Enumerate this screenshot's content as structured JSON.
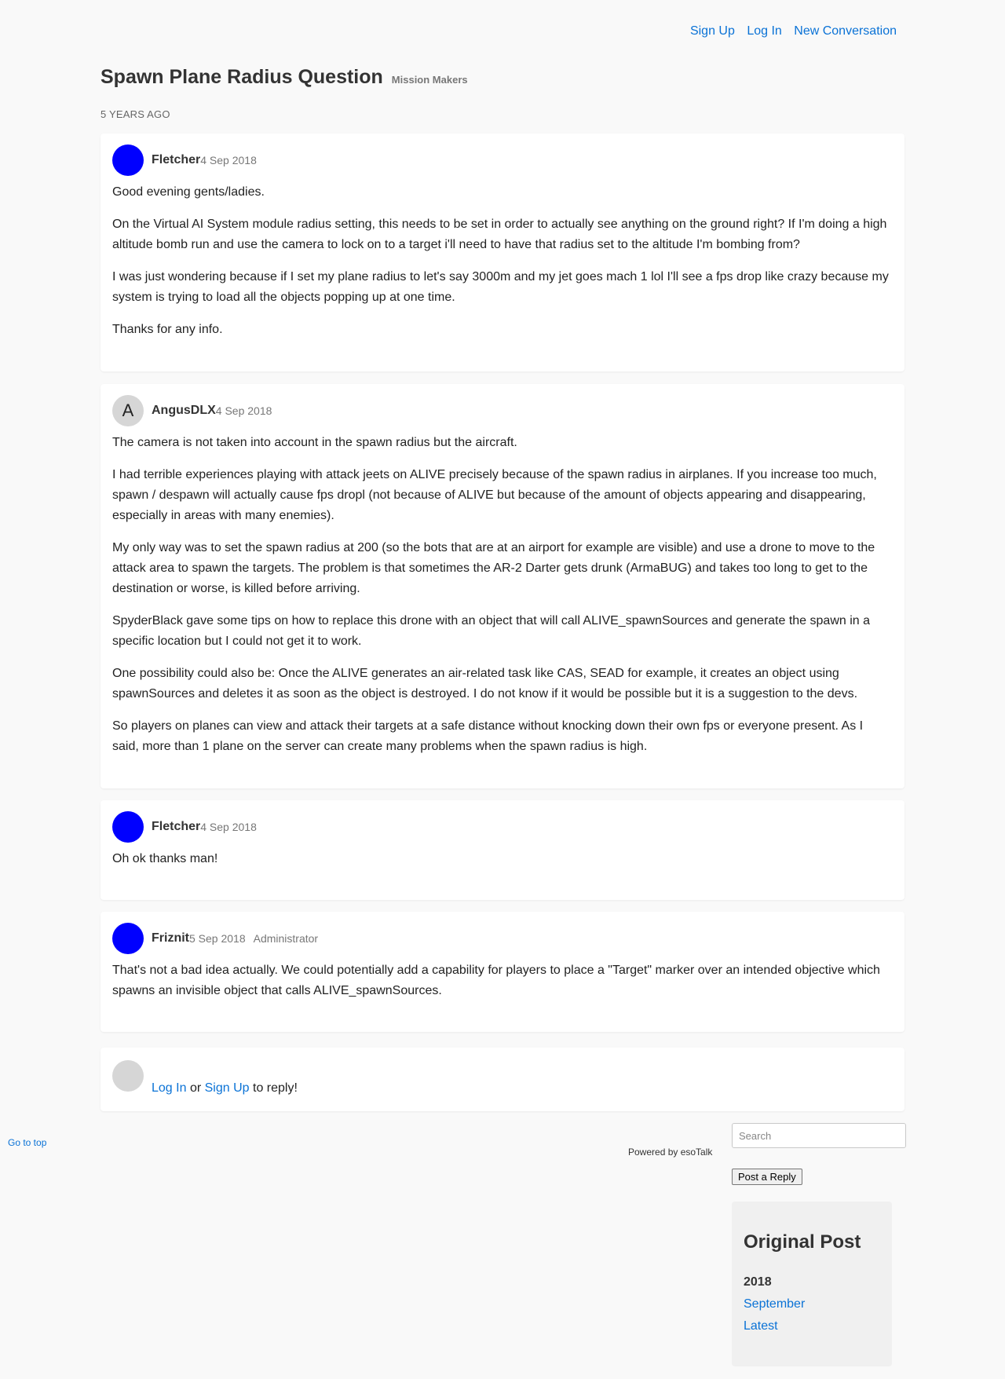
{
  "nav": {
    "sign_up": "Sign Up",
    "log_in": "Log In",
    "new_conversation": "New Conversation"
  },
  "conversation": {
    "title": "Spawn Plane Radius Question",
    "channel": "Mission Makers",
    "age": "5 YEARS AGO"
  },
  "posts": [
    {
      "username": "Fletcher",
      "date": "4 Sep 2018",
      "role": "",
      "avatar_letter": "",
      "avatar_color": "#0000ff",
      "paragraphs": [
        "Good evening gents/ladies.",
        "On the Virtual AI System module radius setting, this needs to be set in order to actually see anything on the ground right? If I'm doing a high altitude bomb run and use the camera to lock on to a target i'll need to have that radius set to the altitude I'm bombing from?",
        "I was just wondering because if I set my plane radius to let's say 3000m and my jet goes mach 1 lol I'll see a fps drop like crazy because my system is trying to load all the objects popping up at one time.",
        "Thanks for any info."
      ]
    },
    {
      "username": "AngusDLX",
      "date": "4 Sep 2018",
      "role": "",
      "avatar_letter": "A",
      "avatar_color": "#d6d6d6",
      "paragraphs": [
        "The camera is not taken into account in the spawn radius but the aircraft.",
        "I had terrible experiences playing with attack jeets on ALIVE precisely because of the spawn radius in airplanes. If you increase too much, spawn / despawn will actually cause fps dropl (not because of ALIVE but because of the amount of objects appearing and disappearing, especially in areas with many enemies).",
        "My only way was to set the spawn radius at 200 (so the bots that are at an airport for example are visible) and use a drone to move to the attack area to spawn the targets. The problem is that sometimes the AR-2 Darter gets drunk (ArmaBUG) and takes too long to get to the destination or worse, is killed before arriving.",
        "SpyderBlack gave some tips on how to replace this drone with an object that will call ALIVE_spawnSources and generate the spawn in a specific location but I could not get it to work.",
        "One possibility could also be: Once the ALIVE generates an air-related task like CAS, SEAD for example, it creates an object using spawnSources and deletes it as soon as the object is destroyed. I do not know if it would be possible but it is a suggestion to the devs.",
        "So players on planes can view and attack their targets at a safe distance without knocking down their own fps or everyone present. As I said, more than 1 plane on the server can create many problems when the spawn radius is high."
      ]
    },
    {
      "username": "Fletcher",
      "date": "4 Sep 2018",
      "role": "",
      "avatar_letter": "",
      "avatar_color": "#0000ff",
      "paragraphs": [
        "Oh ok thanks man!"
      ]
    },
    {
      "username": "Friznit",
      "date": "5 Sep 2018",
      "role": "Administrator",
      "avatar_letter": "",
      "avatar_color": "#0000ff",
      "paragraphs": [
        "That's not a bad idea actually. We could potentially add a capability for players to place a \"Target\" marker over an intended objective which spawns an invisible object that calls ALIVE_spawnSources."
      ]
    }
  ],
  "reply": {
    "log_in": "Log In",
    "or": "or",
    "sign_up": "Sign Up",
    "suffix": "to reply!"
  },
  "footer": {
    "go_to_top": "Go to top",
    "powered_by": "Powered by esoTalk",
    "search_placeholder": "Search",
    "post_reply_button": "Post a Reply"
  },
  "timeline": {
    "heading": "Original Post",
    "year": "2018",
    "month": "September",
    "latest": "Latest"
  }
}
